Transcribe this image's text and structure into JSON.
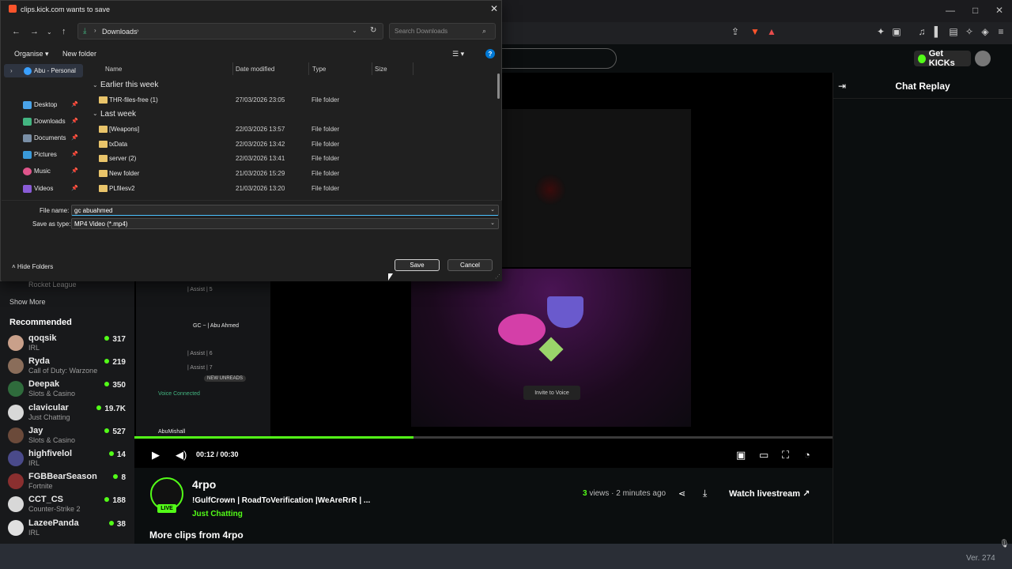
{
  "dialog": {
    "title": "clips.kick.com wants to save",
    "address_crumb": "Downloads",
    "search_placeholder": "Search Downloads",
    "organise": "Organise",
    "new_folder": "New folder",
    "nav_pane": [
      {
        "label": "Abu - Personal"
      },
      {
        "label": "Desktop"
      },
      {
        "label": "Downloads"
      },
      {
        "label": "Documents"
      },
      {
        "label": "Pictures"
      },
      {
        "label": "Music"
      },
      {
        "label": "Videos"
      }
    ],
    "columns": [
      "Name",
      "Date modified",
      "Type",
      "Size"
    ],
    "groups": [
      "Earlier this week",
      "Last week"
    ],
    "files": [
      {
        "name": "THR-files-free (1)",
        "date": "27/03/2026 23:05",
        "type": "File folder"
      },
      {
        "name": "[Weapons]",
        "date": "22/03/2026 13:57",
        "type": "File folder"
      },
      {
        "name": "txData",
        "date": "22/03/2026 13:42",
        "type": "File folder"
      },
      {
        "name": "server (2)",
        "date": "22/03/2026 13:41",
        "type": "File folder"
      },
      {
        "name": "New folder",
        "date": "21/03/2026 15:29",
        "type": "File folder"
      },
      {
        "name": "PLfilesv2",
        "date": "21/03/2026 13:20",
        "type": "File folder"
      }
    ],
    "file_name_label": "File name:",
    "file_name_value": "gc abuahmed",
    "save_type_label": "Save as type:",
    "save_type_value": "MP4 Video (*.mp4)",
    "hide_folders": "Hide Folders",
    "save": "Save",
    "cancel": "Cancel"
  },
  "kick": {
    "get_kicks": "Get KICKs",
    "chat_replay": "Chat Replay",
    "sidebar": {
      "partial_item_category": "Rocket League",
      "show_more": "Show More",
      "recommended": "Recommended",
      "channels": [
        {
          "name": "qoqsik",
          "category": "IRL",
          "viewers": "317"
        },
        {
          "name": "Ryda",
          "category": "Call of Duty: Warzone",
          "viewers": "219"
        },
        {
          "name": "Deepak",
          "category": "Slots & Casino",
          "viewers": "350"
        },
        {
          "name": "clavicular",
          "category": "Just Chatting",
          "viewers": "19.7K"
        },
        {
          "name": "Jay",
          "category": "Slots & Casino",
          "viewers": "527"
        },
        {
          "name": "highfivelol",
          "category": "IRL",
          "viewers": "14"
        },
        {
          "name": "FGBBearSeason",
          "category": "Fortnite",
          "viewers": "8"
        },
        {
          "name": "CCT_CS",
          "category": "Counter-Strike 2",
          "viewers": "188"
        },
        {
          "name": "LazeePanda",
          "category": "IRL",
          "viewers": "38"
        }
      ]
    },
    "player": {
      "time": "00:12 / 00:30",
      "progress": 0.4,
      "invite_to_voice": "Invite to Voice",
      "discord_lines": [
        "| Assist | 5",
        "GC ~ | Abu Ahmed",
        "| Assist | 6",
        "| Assist | 7",
        "Voice Connected",
        "AbuMishall"
      ],
      "new_unreads": "NEW UNREADS"
    },
    "channel": {
      "name": "4rpo",
      "live": "LIVE",
      "title": "!GulfCrown |  RoadToVerification  |WeAreRrR |  ...",
      "category": "Just Chatting",
      "views_count": "3",
      "views_label": "views",
      "time_ago": "· 2 minutes ago",
      "watch_livestream": "Watch livestream",
      "more_clips": "More clips from 4rpo"
    },
    "version": "Ver. 274"
  },
  "colors": {
    "kick_green": "#53fc18",
    "folder": "#e9c46a",
    "help_blue": "#0078d4"
  }
}
